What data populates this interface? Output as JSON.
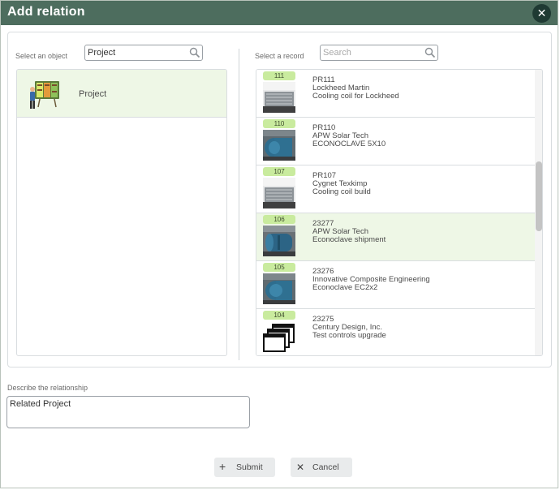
{
  "dialog": {
    "title": "Add relation",
    "close_icon": "close-icon"
  },
  "object_panel": {
    "label": "Select an object",
    "search_value": "Project",
    "items": [
      {
        "label": "Project",
        "icon": "project-board-icon",
        "selected": true
      }
    ]
  },
  "record_panel": {
    "label": "Select a record",
    "search_placeholder": "Search",
    "records": [
      {
        "badge": "111",
        "id": "PR111",
        "company": "Lockheed Martin",
        "description": "Cooling coil for Lockheed",
        "thumb": "cooling-coil-image",
        "selected": false
      },
      {
        "badge": "110",
        "id": "PR110",
        "company": "APW Solar Tech",
        "description": "ECONOCLAVE 5X10",
        "thumb": "autoclave-image",
        "selected": false
      },
      {
        "badge": "107",
        "id": "PR107",
        "company": "Cygnet Texkimp",
        "description": "Cooling coil build",
        "thumb": "cooling-coil-image",
        "selected": false
      },
      {
        "badge": "106",
        "id": "23277",
        "company": "APW Solar Tech",
        "description": "Econoclave shipment",
        "thumb": "autoclave-image",
        "selected": true
      },
      {
        "badge": "105",
        "id": "23276",
        "company": "Innovative Composite Engineering",
        "description": "Econoclave EC2x2",
        "thumb": "autoclave-image",
        "selected": false
      },
      {
        "badge": "104",
        "id": "23275",
        "company": "Century Design, Inc.",
        "description": "Test controls upgrade",
        "thumb": "windows-icon",
        "selected": false
      }
    ]
  },
  "relationship": {
    "label": "Describe the relationship",
    "value": "Related Project"
  },
  "buttons": {
    "submit": "Submit",
    "cancel": "Cancel"
  },
  "colors": {
    "titlebar": "#4d6d5e",
    "selected_row": "#eef7e6",
    "badge": "#c9eb9e"
  }
}
